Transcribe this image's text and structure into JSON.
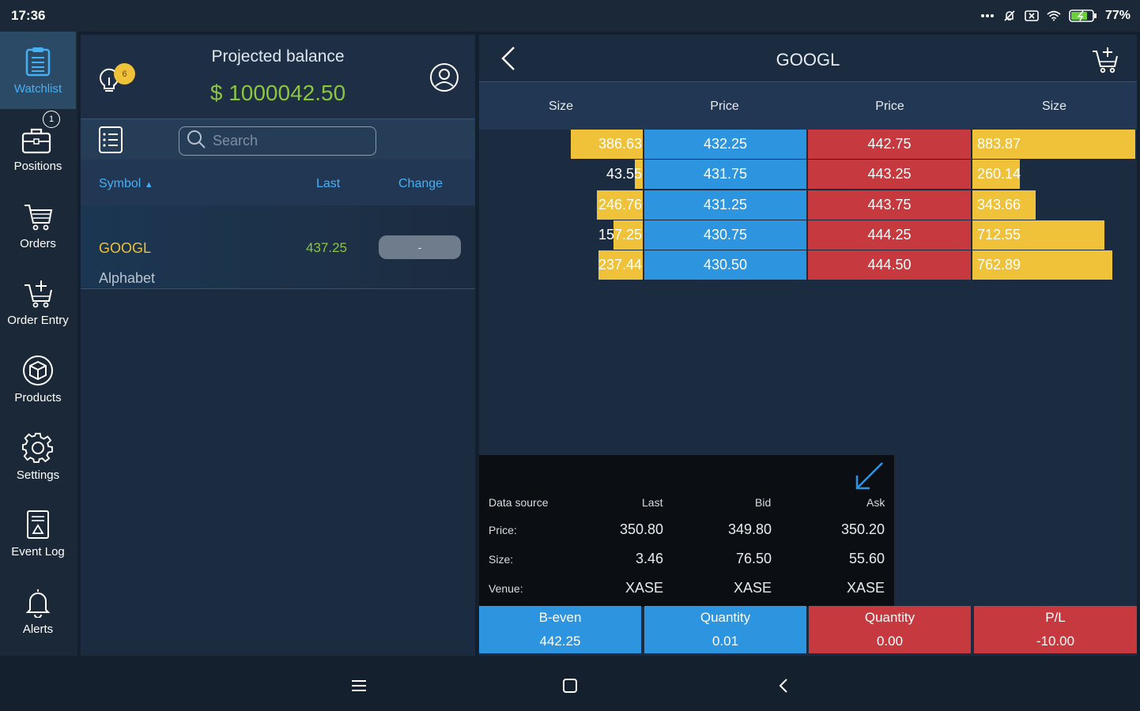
{
  "status_bar": {
    "time": "17:36",
    "battery": "77%",
    "icons": [
      "more-dots-icon",
      "bell-off-icon",
      "close-box-icon",
      "wifi-icon",
      "battery-charging-icon"
    ]
  },
  "sidebar": {
    "items": [
      {
        "label": "Watchlist",
        "icon": "watchlist-icon",
        "active": true
      },
      {
        "label": "Positions",
        "icon": "briefcase-icon",
        "badge": "1"
      },
      {
        "label": "Orders",
        "icon": "cart-icon"
      },
      {
        "label": "Order Entry",
        "icon": "cart-add-icon"
      },
      {
        "label": "Products",
        "icon": "cube-icon"
      },
      {
        "label": "Settings",
        "icon": "gear-icon"
      },
      {
        "label": "Event Log",
        "icon": "event-log-icon"
      },
      {
        "label": "Alerts",
        "icon": "bell-icon"
      }
    ]
  },
  "balance": {
    "title": "Projected balance",
    "value": "$ 1000042.50",
    "notifications": "6"
  },
  "search": {
    "placeholder": "Search"
  },
  "watchlist": {
    "columns": {
      "symbol": "Symbol",
      "last": "Last",
      "change": "Change"
    },
    "rows": [
      {
        "symbol": "GOOGL",
        "description": "Alphabet",
        "last": "437.25",
        "change": "-"
      }
    ]
  },
  "orderbook": {
    "title": "GOOGL",
    "headers": [
      "Size",
      "Price",
      "Price",
      "Size"
    ],
    "rows": [
      {
        "bid_size": "386.63",
        "bid_price": "432.25",
        "ask_price": "442.75",
        "ask_size": "883.87",
        "bid_fill": 0.44,
        "ask_fill": 1.0
      },
      {
        "bid_size": "43.55",
        "bid_price": "431.75",
        "ask_price": "443.25",
        "ask_size": "260.14",
        "bid_fill": 0.05,
        "ask_fill": 0.29
      },
      {
        "bid_size": "246.76",
        "bid_price": "431.25",
        "ask_price": "443.75",
        "ask_size": "343.66",
        "bid_fill": 0.28,
        "ask_fill": 0.39
      },
      {
        "bid_size": "157.25",
        "bid_price": "430.75",
        "ask_price": "444.25",
        "ask_size": "712.55",
        "bid_fill": 0.18,
        "ask_fill": 0.81
      },
      {
        "bid_size": "237.44",
        "bid_price": "430.50",
        "ask_price": "444.50",
        "ask_size": "762.89",
        "bid_fill": 0.27,
        "ask_fill": 0.86
      }
    ]
  },
  "quote": {
    "headers": {
      "source": "Data source",
      "last": "Last",
      "bid": "Bid",
      "ask": "Ask"
    },
    "rows": [
      {
        "label": "Price:",
        "last": "350.80",
        "bid": "349.80",
        "ask": "350.20"
      },
      {
        "label": "Size:",
        "last": "3.46",
        "bid": "76.50",
        "ask": "55.60"
      },
      {
        "label": "Venue:",
        "last": "XASE",
        "bid": "XASE",
        "ask": "XASE"
      }
    ]
  },
  "summary": [
    {
      "label": "B-even",
      "value": "442.25",
      "color": "blue"
    },
    {
      "label": "Quantity",
      "value": "0.01",
      "color": "blue"
    },
    {
      "label": "Quantity",
      "value": "0.00",
      "color": "red"
    },
    {
      "label": "P/L",
      "value": "-10.00",
      "color": "red"
    }
  ],
  "colors": {
    "accent_blue": "#2d95e0",
    "ask_red": "#c6393f",
    "size_yellow": "#f0c23a",
    "positive_green": "#8cc63f",
    "link_blue": "#46b0f5"
  }
}
